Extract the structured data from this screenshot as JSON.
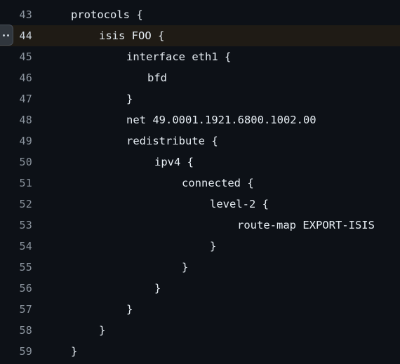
{
  "editor": {
    "partial_top_text": "}",
    "highlighted_line": 44,
    "lines": [
      {
        "num": "43",
        "text": "protocols {"
      },
      {
        "num": "44",
        "text": "isis FOO {"
      },
      {
        "num": "45",
        "text": "interface eth1 {"
      },
      {
        "num": "46",
        "text": "bfd"
      },
      {
        "num": "47",
        "text": "}"
      },
      {
        "num": "48",
        "text": "net 49.0001.1921.6800.1002.00"
      },
      {
        "num": "49",
        "text": "redistribute {"
      },
      {
        "num": "50",
        "text": "ipv4 {"
      },
      {
        "num": "51",
        "text": "connected {"
      },
      {
        "num": "52",
        "text": "level-2 {"
      },
      {
        "num": "53",
        "text": "route-map EXPORT-ISIS"
      },
      {
        "num": "54",
        "text": "}"
      },
      {
        "num": "55",
        "text": "}"
      },
      {
        "num": "56",
        "text": "}"
      },
      {
        "num": "57",
        "text": "}"
      },
      {
        "num": "58",
        "text": "}"
      },
      {
        "num": "59",
        "text": "}"
      }
    ]
  },
  "line_menu": {
    "icon": "kebab-horizontal-icon"
  },
  "colors": {
    "background": "#0d1117",
    "highlight": "#1f1b15",
    "line_number": "#8b949e",
    "code_text": "#e6edf3"
  }
}
